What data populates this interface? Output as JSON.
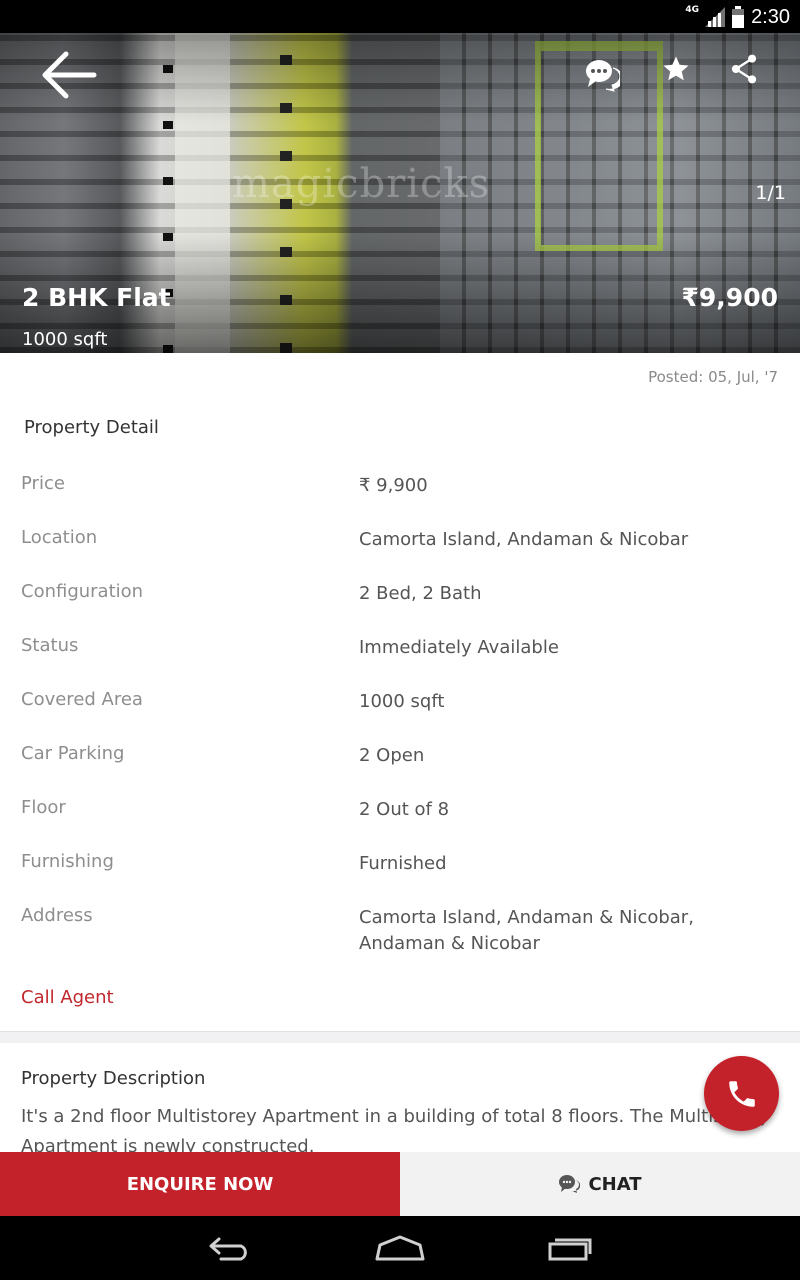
{
  "status_bar": {
    "time": "2:30",
    "network": "4G",
    "icons": [
      "signal-icon",
      "battery-icon"
    ]
  },
  "hero": {
    "watermark": "magicbricks",
    "counter": "1/1",
    "title": "2 BHK Flat",
    "area": "1000 sqft",
    "price": "₹9,900",
    "icons": [
      "back-arrow-icon",
      "chat-bubbles-icon",
      "star-icon",
      "share-icon"
    ]
  },
  "posted": "Posted: 05, Jul, '7",
  "property_detail": {
    "title": "Property Detail",
    "rows": [
      {
        "label": "Price",
        "value": "₹ 9,900"
      },
      {
        "label": "Location",
        "value": "Camorta Island, Andaman & Nicobar"
      },
      {
        "label": "Configuration",
        "value": "2 Bed, 2 Bath"
      },
      {
        "label": "Status",
        "value": "Immediately Available"
      },
      {
        "label": "Covered Area",
        "value": "1000 sqft"
      },
      {
        "label": "Car Parking",
        "value": "2 Open"
      },
      {
        "label": "Floor",
        "value": "2 Out of 8"
      },
      {
        "label": "Furnishing",
        "value": "Furnished"
      },
      {
        "label": "Address",
        "value": "Camorta Island, Andaman & Nicobar, Andaman & Nicobar"
      }
    ],
    "call_agent": "Call Agent"
  },
  "description": {
    "title": "Property Description",
    "text": "It's a 2nd floor Multistorey Apartment in a building of total 8 floors. The Multistorey Apartment is newly constructed."
  },
  "actions": {
    "enquire": "ENQUIRE NOW",
    "chat": "CHAT"
  },
  "colors": {
    "brand_red": "#c4222a",
    "link_red": "#c0282d"
  },
  "nav": {
    "icons": [
      "back-nav-icon",
      "home-nav-icon",
      "recents-nav-icon"
    ]
  }
}
